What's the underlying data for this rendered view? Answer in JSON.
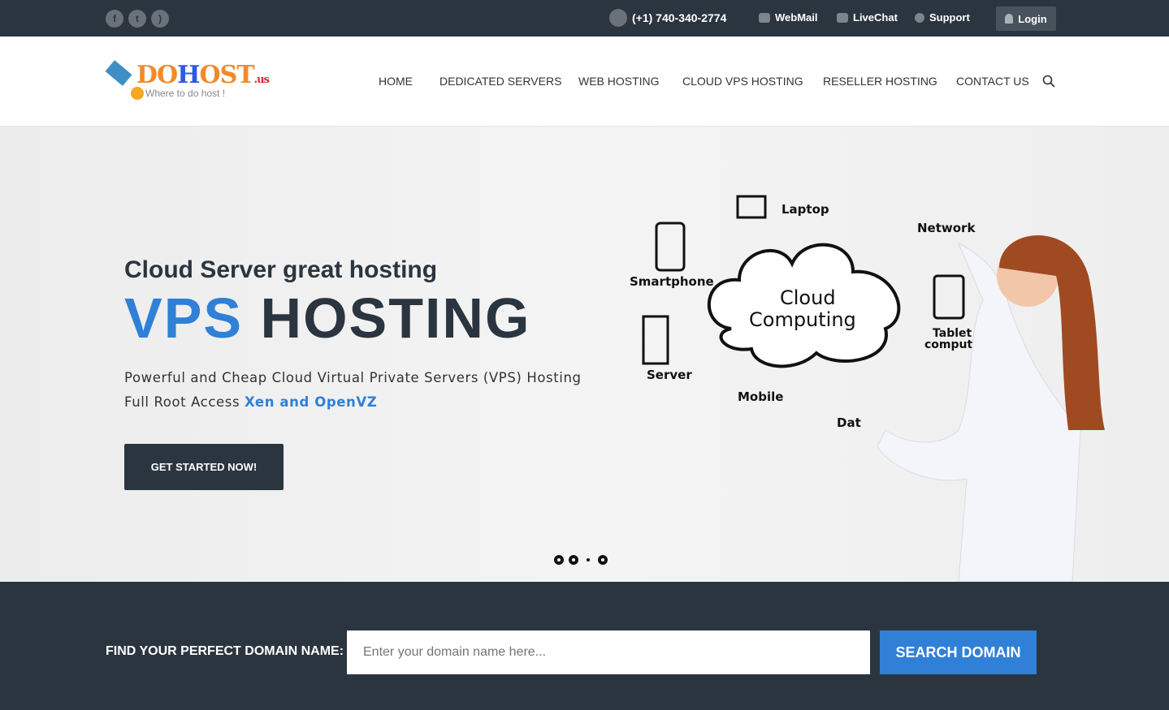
{
  "topbar": {
    "social": [
      "facebook-icon",
      "twitter-icon",
      "rss-icon"
    ],
    "phone": "(+1) 740-340-2774",
    "webmail": "WebMail",
    "livechat": "LiveChat",
    "support": "Support",
    "login": "Login"
  },
  "logo": {
    "name_do": "DO",
    "name_h": "H",
    "name_ost": "OST",
    "tld": ".us",
    "tagline": "Where to do host !"
  },
  "nav": [
    "HOME",
    "DEDICATED SERVERS",
    "WEB HOSTING",
    "CLOUD VPS HOSTING",
    "RESELLER HOSTING",
    "CONTACT US"
  ],
  "hero": {
    "subtitle": "Cloud Server great hosting",
    "title_blue": "VPS",
    "title_dark": "HOSTING",
    "line1": "Powerful and Cheap Cloud Virtual Private Servers (VPS) Hosting",
    "line2_prefix": "Full Root Access",
    "line2_highlight": "Xen and OpenVZ",
    "cta": "GET STARTED NOW!",
    "illustration": {
      "cloud1": "Cloud",
      "cloud2": "Computing",
      "laptop": "Laptop",
      "network": "Network",
      "smartphone": "Smartphone",
      "tablet1": "Tablet",
      "tablet2": "computer",
      "server": "Server",
      "mobile": "Mobile",
      "data": "Dat"
    },
    "slides": 4,
    "active_slide": 3
  },
  "domain": {
    "label": "FIND YOUR PERFECT DOMAIN NAME:",
    "placeholder": "Enter your domain name here...",
    "button": "SEARCH DOMAIN"
  },
  "colors": {
    "dark": "#2b3540",
    "accent": "#2f80d6"
  }
}
